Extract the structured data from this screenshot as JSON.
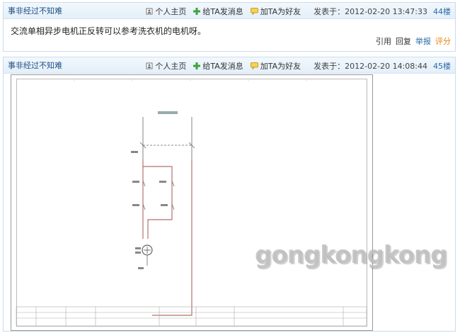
{
  "posts": [
    {
      "author": "事非经过不知难",
      "actions": {
        "profile": "个人主页",
        "message": "给TA发消息",
        "friend": "加TA为好友"
      },
      "posted": "发表于：2012-02-20 13:47:33",
      "floor": "44楼",
      "content": "交流单相异步电机正反转可以参考洗衣机的电机呀。",
      "footer": {
        "quote": "引用",
        "reply": "回复",
        "report": "举报",
        "rate": "评分"
      }
    },
    {
      "author": "事非经过不知难",
      "actions": {
        "profile": "个人主页",
        "message": "给TA发消息",
        "friend": "加TA为好友"
      },
      "posted": "发表于：2012-02-20 14:08:44",
      "floor": "45楼"
    }
  ],
  "watermark": "gongkongkong"
}
